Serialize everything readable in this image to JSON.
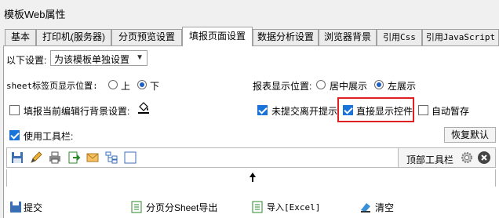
{
  "window": {
    "title": "模板Web属性"
  },
  "tabs": [
    {
      "label": "基本"
    },
    {
      "label": "打印机(服务器)"
    },
    {
      "label": "分页预览设置"
    },
    {
      "label": "填报页面设置"
    },
    {
      "label": "数据分析设置"
    },
    {
      "label": "浏览器背景"
    },
    {
      "label": "引用Css"
    },
    {
      "label": "引用JavaScript"
    }
  ],
  "settings": {
    "scope_label": "以下设置:",
    "scope_value": "为该模板单独设置",
    "sheet_tab_label": "sheet标签页显示位置:",
    "sheet_tab_options": [
      "上",
      "下"
    ],
    "sheet_tab_selected": "下",
    "report_pos_label": "报表显示位置:",
    "report_pos_options": [
      "居中展示",
      "左展示"
    ],
    "report_pos_selected": "左展示",
    "fill_bg_label": "填报当前编辑行背景设置:",
    "unsubmitted_warn_label": "未提交离开提示",
    "direct_show_label": "直接显示控件",
    "auto_save_label": "自动暂存",
    "use_toolbar_label": "使用工具栏:",
    "reset_label": "恢复默认",
    "top_toolbar_label": "顶部工具栏"
  },
  "toolbar_icons": [
    "save-icon",
    "edit-icon",
    "print-icon",
    "export-icon",
    "email-icon",
    "structure-icon",
    "blank-icon"
  ],
  "buttons_list": [
    {
      "label": "提交",
      "icon": "submit-icon"
    },
    {
      "label": "分页分Sheet导出",
      "icon": "export-sheet-icon"
    },
    {
      "label": "导入[Excel]",
      "icon": "import-excel-icon"
    },
    {
      "label": "清空",
      "icon": "clear-icon"
    }
  ],
  "colors": {
    "accent": "#1a73d9",
    "highlight": "#e02020"
  }
}
